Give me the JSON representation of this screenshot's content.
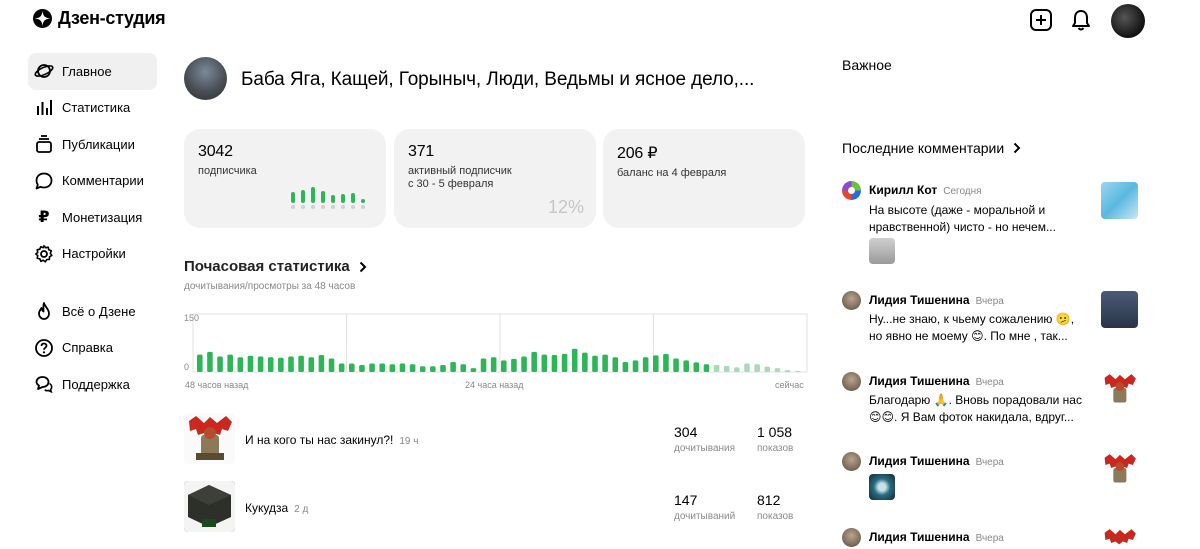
{
  "header": {
    "logo_text": "Дзен-студия",
    "icons": [
      "dzen-logo-icon",
      "add-icon",
      "bell-icon",
      "avatar"
    ]
  },
  "sidebar": {
    "items": [
      {
        "label": "Главное",
        "icon": "planet-icon",
        "active": true
      },
      {
        "label": "Статистика",
        "icon": "bar-chart-icon"
      },
      {
        "label": "Публикации",
        "icon": "stack-icon"
      },
      {
        "label": "Комментарии",
        "icon": "comment-icon"
      },
      {
        "label": "Монетизация",
        "icon": "ruble-icon"
      },
      {
        "label": "Настройки",
        "icon": "gear-icon"
      }
    ],
    "secondary": [
      {
        "label": "Всё о Дзене",
        "icon": "flame-icon"
      },
      {
        "label": "Справка",
        "icon": "question-icon"
      },
      {
        "label": "Поддержка",
        "icon": "chat-icon"
      }
    ]
  },
  "channel": {
    "title": "Баба Яга, Кащей, Горыныч, Люди, Ведьмы и ясное дело,..."
  },
  "cards": [
    {
      "value": "3042",
      "caption": "подписчика"
    },
    {
      "value": "371",
      "caption": "активный подписчик",
      "caption2": "с 30 - 5 февраля",
      "percent": "12%"
    },
    {
      "value": "206 ₽",
      "caption": "баланс на 4 февраля"
    }
  ],
  "hourly": {
    "title": "Почасовая статистика",
    "subtitle": "дочитывания/просмотры за 48 часов",
    "x_labels": [
      "48 часов назад",
      "24 часа назад",
      "сейчас"
    ]
  },
  "chart_data": {
    "type": "bar",
    "title": "Почасовая статистика",
    "ylim": [
      0,
      150
    ],
    "y_ticks": [
      "150",
      "0"
    ],
    "x_labels": [
      "48 часов назад",
      "24 часа назад",
      "сейчас"
    ],
    "values": [
      45,
      52,
      40,
      45,
      38,
      42,
      40,
      38,
      37,
      40,
      42,
      38,
      44,
      35,
      22,
      22,
      18,
      22,
      22,
      20,
      22,
      20,
      15,
      15,
      18,
      26,
      20,
      10,
      35,
      38,
      30,
      34,
      40,
      52,
      45,
      44,
      47,
      60,
      50,
      42,
      45,
      38,
      26,
      30,
      38,
      43,
      47,
      35,
      30,
      25,
      20,
      18,
      16,
      12,
      22,
      20,
      14,
      10,
      5,
      3
    ],
    "colors": {
      "bar": "#2cb757",
      "bar_faded": "#a8dcb8",
      "grid": "#e2e2e2"
    }
  },
  "mini_chart_data": {
    "type": "bar",
    "values": [
      12,
      15,
      18,
      14,
      9,
      10,
      11,
      4
    ]
  },
  "publications": [
    {
      "title": "И на кого ты нас закинул?!",
      "time": "19 ч",
      "reads": "304",
      "reads_label": "дочитывания",
      "views": "1 058",
      "views_label": "показов"
    },
    {
      "title": "Кукудза",
      "time": "2 д",
      "reads": "147",
      "reads_label": "дочитываний",
      "views": "812",
      "views_label": "показов"
    }
  ],
  "right": {
    "important_title": "Важное",
    "comments_title": "Последние комментарии",
    "comments": [
      {
        "name": "Кирилл Кот",
        "when": "Сегодня",
        "text": "На высоте (даже - моральной и нравственной) чисто - но нечем..."
      },
      {
        "name": "Лидия Тишенина",
        "when": "Вчера",
        "text": "Ну...не знаю, к чьему сожалению 🫤, но явно не моему 😊. По мне , так..."
      },
      {
        "name": "Лидия Тишенина",
        "when": "Вчера",
        "text": "Благодарю 🙏. Вновь порадовали нас 😊😊. Я Вам фоток накидала, вдруг..."
      },
      {
        "name": "Лидия Тишенина",
        "when": "Вчера",
        "text": ""
      },
      {
        "name": "Лидия Тишенина",
        "when": "Вчера",
        "text": ""
      }
    ]
  }
}
